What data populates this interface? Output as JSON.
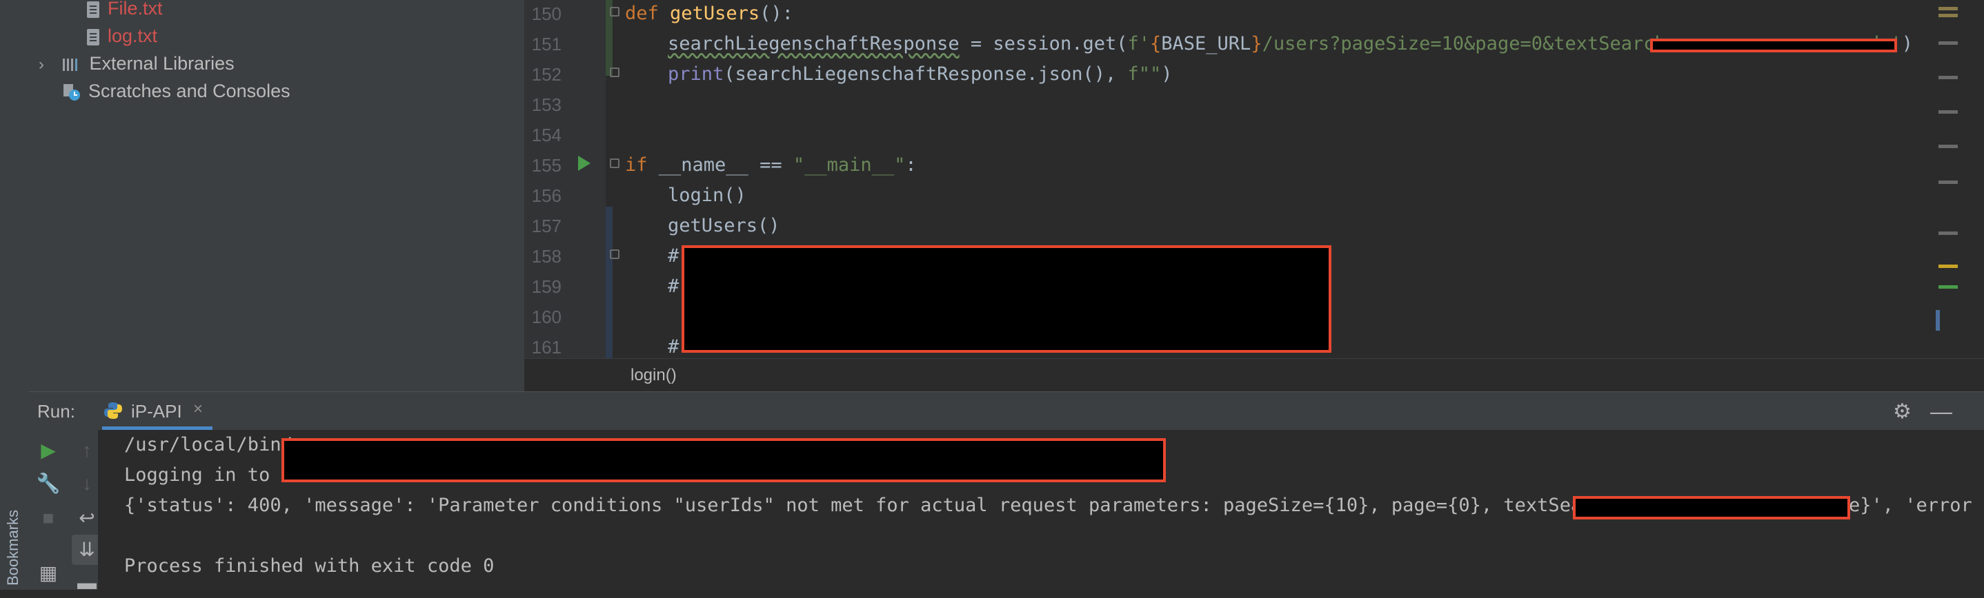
{
  "sidebar": {
    "bookmarks_label": "Bookmarks",
    "tree": {
      "file_txt": "File.txt",
      "log_txt": "log.txt",
      "external_libraries": "External Libraries",
      "scratches": "Scratches and Consoles"
    }
  },
  "editor": {
    "lines": [
      {
        "n": "150"
      },
      {
        "n": "151"
      },
      {
        "n": "152"
      },
      {
        "n": "153"
      },
      {
        "n": "154"
      },
      {
        "n": "155"
      },
      {
        "n": "156"
      },
      {
        "n": "157"
      },
      {
        "n": "158"
      },
      {
        "n": "159"
      },
      {
        "n": "160"
      },
      {
        "n": "161"
      }
    ],
    "code": {
      "l150_kw": "def",
      "l150_fn": "getUsers",
      "l150_rest": "():",
      "l151_var": "searchLiegenschaftResponse",
      "l151_mid": " = session.get(",
      "l151_fprefix": "f'",
      "l151_brace_open": "{",
      "l151_base": "BASE_URL",
      "l151_brace_close": "}",
      "l151_path": "/users?pageSize=10&page=0&textSearch=c",
      "l151_tail": "de'",
      "l151_close": ")",
      "l152_print": "print",
      "l152_args": "(searchLiegenschaftResponse.json(), ",
      "l152_fstr": "f\"\"",
      "l152_close": ")",
      "l155_kw": "if",
      "l155_mid": " __name__ == ",
      "l155_str": "\"__main__\"",
      "l155_colon": ":",
      "l156": "login()",
      "l157": "getUsers()",
      "l158": "#",
      "l159": "#",
      "l161": "#"
    },
    "breadcrumb": "login()"
  },
  "run_panel": {
    "title": "Run:",
    "tab_name": "iP-API",
    "tab_close": "×",
    "console": {
      "line1": "/usr/local/bin/",
      "line2": "Logging in to i",
      "line3_start": "{'status': 400, 'message': 'Parameter conditions \"userIds\" not met for actual request parameters: pageSize={10}, page={0}, textSearch={",
      "line3_end": "e}', 'error",
      "line4": "",
      "line5": "Process finished with exit code 0"
    }
  },
  "colors": {
    "redaction_border": "#e8472f",
    "keyword": "#cc7832",
    "function": "#ffc66d",
    "string": "#6a8759"
  }
}
